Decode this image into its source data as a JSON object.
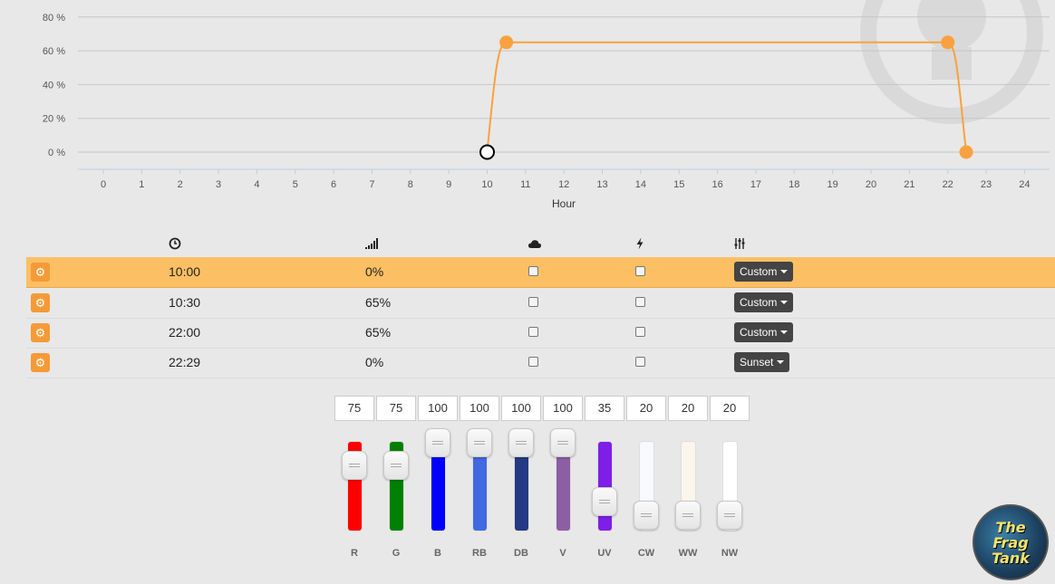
{
  "chart_data": {
    "type": "line",
    "xlabel": "Hour",
    "ylabel": "",
    "title": "",
    "x_ticks": [
      0,
      1,
      2,
      3,
      4,
      5,
      6,
      7,
      8,
      9,
      10,
      11,
      12,
      13,
      14,
      15,
      16,
      17,
      18,
      19,
      20,
      21,
      22,
      23,
      24
    ],
    "y_ticks": [
      "0 %",
      "20 %",
      "40 %",
      "60 %",
      "80 %"
    ],
    "xlim": [
      0,
      24
    ],
    "ylim": [
      0,
      80
    ],
    "series": [
      {
        "x": [
          10,
          10.5,
          22,
          22.48
        ],
        "y": [
          0,
          65,
          65,
          0
        ]
      }
    ],
    "line_color": "#f9a13f",
    "grid": true
  },
  "schedule": {
    "headers": {
      "time_icon": "clock-icon",
      "level_icon": "signal-icon",
      "cloud_icon": "cloud-icon",
      "lightning_icon": "lightning-icon",
      "mode_icon": "sliders-icon"
    },
    "rows": [
      {
        "time": "10:00",
        "level": "0%",
        "cloud": false,
        "lightning": false,
        "mode": "Custom",
        "active": true
      },
      {
        "time": "10:30",
        "level": "65%",
        "cloud": false,
        "lightning": false,
        "mode": "Custom",
        "active": false
      },
      {
        "time": "22:00",
        "level": "65%",
        "cloud": false,
        "lightning": false,
        "mode": "Custom",
        "active": false
      },
      {
        "time": "22:29",
        "level": "0%",
        "cloud": false,
        "lightning": false,
        "mode": "Sunset",
        "active": false
      }
    ]
  },
  "channels": [
    {
      "label": "R",
      "value": "75",
      "level": 0.75,
      "color": "#ff0000"
    },
    {
      "label": "G",
      "value": "75",
      "level": 0.75,
      "color": "#008000"
    },
    {
      "label": "B",
      "value": "100",
      "level": 1.0,
      "color": "#0000ff"
    },
    {
      "label": "RB",
      "value": "100",
      "level": 1.0,
      "color": "#4169e1"
    },
    {
      "label": "DB",
      "value": "100",
      "level": 1.0,
      "color": "#253a84"
    },
    {
      "label": "V",
      "value": "100",
      "level": 1.0,
      "color": "#8e5ea2"
    },
    {
      "label": "UV",
      "value": "35",
      "level": 0.35,
      "color": "#7f1ee6"
    },
    {
      "label": "CW",
      "value": "20",
      "level": 0.2,
      "color": "#f7f9fc"
    },
    {
      "label": "WW",
      "value": "20",
      "level": 0.2,
      "color": "#fbf6e9"
    },
    {
      "label": "NW",
      "value": "20",
      "level": 0.2,
      "color": "#ffffff"
    }
  ],
  "logo": {
    "line1": "The",
    "line2": "Frag",
    "line3": "Tank"
  },
  "watermark_icon": "lightbulb-icon"
}
